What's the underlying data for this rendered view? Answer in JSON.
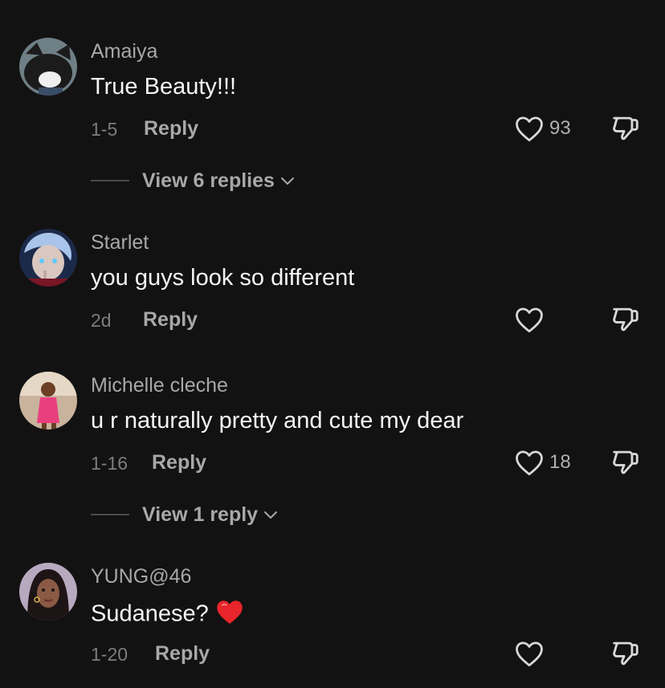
{
  "comments": [
    {
      "username": "Amaiya",
      "text": "True Beauty!!!",
      "date": "1-5",
      "reply_label": "Reply",
      "like_count": "93",
      "view_replies": "View 6 replies"
    },
    {
      "username": "Starlet",
      "text": "you guys look so different",
      "date": "2d",
      "reply_label": "Reply",
      "like_count": "",
      "view_replies": ""
    },
    {
      "username": "Michelle cleche",
      "text": "u r naturally pretty and cute my dear",
      "date": "1-16",
      "reply_label": "Reply",
      "like_count": "18",
      "view_replies": "View 1 reply"
    },
    {
      "username": "YUNG@46",
      "text": "Sudanese?",
      "emoji": "red-heart",
      "date": "1-20",
      "reply_label": "Reply",
      "like_count": "",
      "view_replies": ""
    }
  ],
  "icons": {
    "like": "heart-outline-icon",
    "dislike": "thumbs-down-icon",
    "expand": "chevron-down-icon"
  },
  "colors": {
    "background": "#121212",
    "text": "#f5f5f5",
    "secondary": "#a8a8a8",
    "heart_emoji": "#e8252b"
  }
}
